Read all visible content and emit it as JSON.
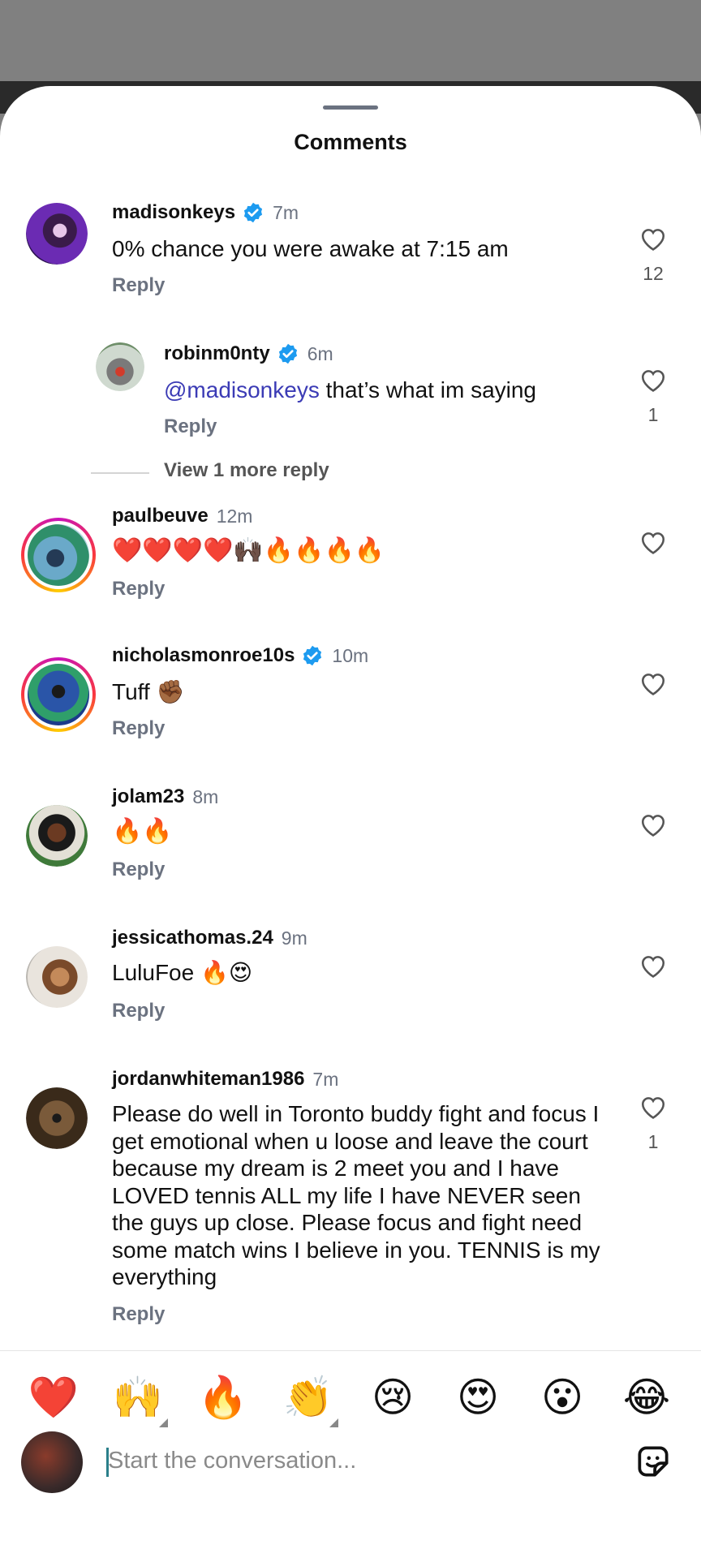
{
  "sheet": {
    "title": "Comments"
  },
  "comments": [
    {
      "username": "madisonkeys",
      "time": "7m",
      "text": "0% chance you were awake at 7:15 am",
      "reply": "Reply",
      "likes": "12"
    },
    {
      "username": "robinm0nty",
      "time": "6m",
      "mention": "@madisonkeys",
      "text": " that’s what im saying",
      "reply": "Reply",
      "likes": "1"
    },
    {
      "username": "paulbeuve",
      "time": "12m",
      "text": "❤️❤️❤️❤️🙌🏿🔥🔥🔥🔥",
      "reply": "Reply"
    },
    {
      "username": "nicholasmonroe10s",
      "time": "10m",
      "text": "Tuff ✊🏾",
      "reply": "Reply"
    },
    {
      "username": "jolam23",
      "time": "8m",
      "text": "🔥🔥",
      "reply": "Reply"
    },
    {
      "username": "jessicathomas.24",
      "time": "9m",
      "text": "LuluFoe 🔥😍",
      "reply": "Reply"
    },
    {
      "username": "jordanwhiteman1986",
      "time": "7m",
      "text": "Please do well in Toronto buddy fight and focus I get emotional when u loose and leave the court because my dream is 2 meet you and I have LOVED tennis ALL my life I have NEVER seen the guys up close. Please focus and fight need some match wins I believe in you. TENNIS is my everything",
      "reply": "Reply",
      "likes": "1"
    }
  ],
  "view_more": "View 1 more reply",
  "reactions": [
    "❤️",
    "🙌",
    "🔥",
    "👏",
    "😢",
    "😍",
    "😮",
    "😂"
  ],
  "composer": {
    "placeholder": "Start the conversation..."
  },
  "icons": {
    "heart": "heart-icon",
    "verified": "verified-badge-icon",
    "sticker": "sticker-icon"
  },
  "colors": {
    "verified": "#1d9bf0",
    "mention": "#3b3bb5",
    "muted": "#6b7280"
  }
}
